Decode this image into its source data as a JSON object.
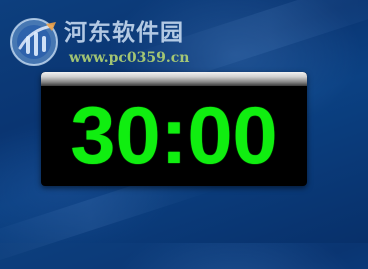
{
  "watermark": {
    "title": "河东软件园",
    "url": "www.pc0359.cn",
    "logo_icon": "hedong-logo-icon"
  },
  "timer": {
    "display": "30:00",
    "digit_color": "#10ee10",
    "background_color": "#000000"
  },
  "colors": {
    "desktop_background": "#0b3c7d"
  }
}
